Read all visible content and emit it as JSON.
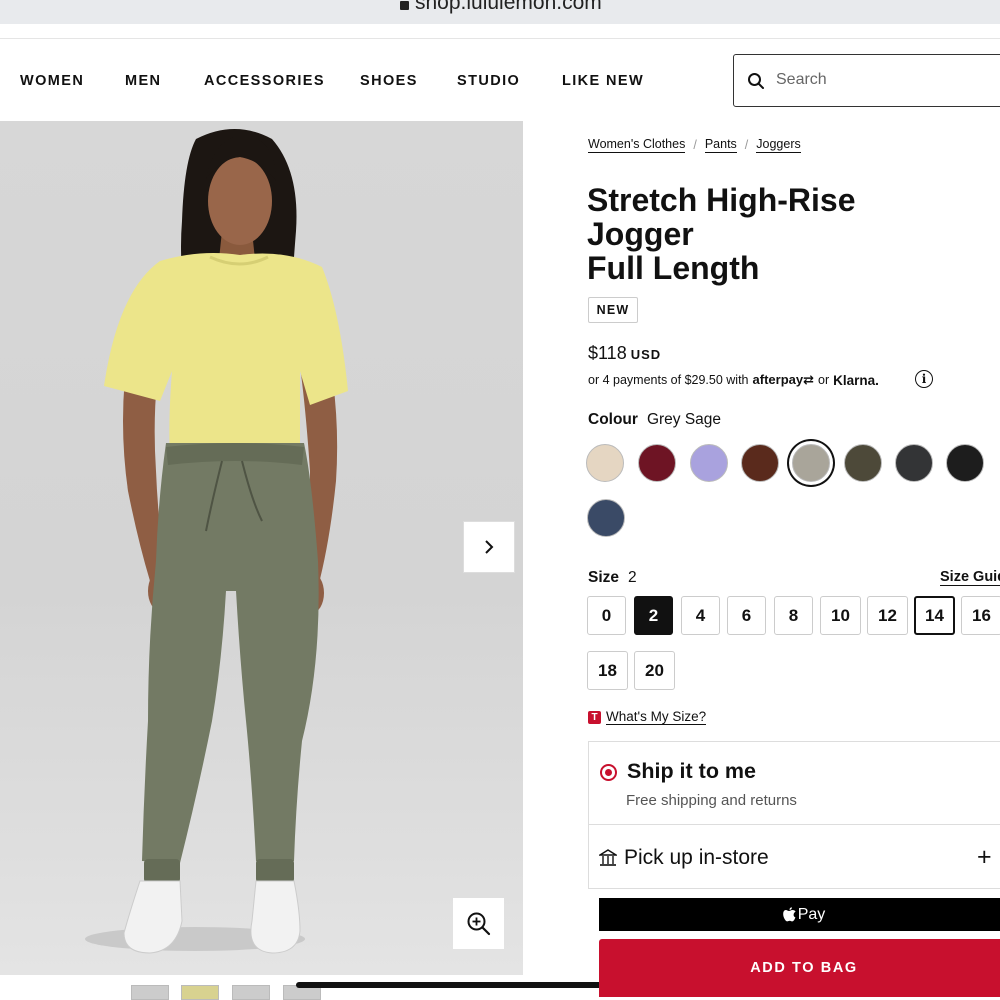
{
  "browser": {
    "url": "shop.lululemon.com"
  },
  "nav": {
    "items": [
      "WOMEN",
      "MEN",
      "ACCESSORIES",
      "SHOES",
      "STUDIO",
      "LIKE NEW"
    ],
    "search_placeholder": "Search"
  },
  "breadcrumb": [
    "Women's Clothes",
    "Pants",
    "Joggers"
  ],
  "breadcrumb_separator": "/",
  "product": {
    "title_lines": [
      "Stretch High-Rise",
      "Jogger",
      "Full Length"
    ],
    "badge": "NEW",
    "price": "$118",
    "currency": "USD",
    "installments": {
      "prefix": "or 4 payments of $29.50 with",
      "afterpay": "afterpay",
      "or": "or",
      "klarna": "Klarna."
    },
    "info_icon": "i"
  },
  "colour": {
    "label": "Colour",
    "selected_name": "Grey Sage",
    "swatches": [
      {
        "color": "#e5d6c2"
      },
      {
        "color": "#6e1424"
      },
      {
        "color": "#a9a2de"
      },
      {
        "color": "#5a2a1c"
      },
      {
        "color": "#a9a59a",
        "selected": true
      },
      {
        "color": "#4d4939"
      },
      {
        "color": "#333436"
      },
      {
        "color": "#1d1d1d"
      },
      {
        "color": "#3a4a66"
      }
    ]
  },
  "size": {
    "label": "Size",
    "selected": "2",
    "guide_label": "Size Guide",
    "options": [
      "0",
      "2",
      "4",
      "6",
      "8",
      "10",
      "12",
      "14",
      "16",
      "18",
      "20"
    ],
    "whats_my_size_icon": "T",
    "whats_my_size": "What's My Size?"
  },
  "shipping": {
    "ship_title": "Ship it to me",
    "ship_sub": "Free shipping and returns",
    "pickup_title": "Pick up in-store",
    "pickup_expand": "+"
  },
  "actions": {
    "applepay_label": "Pay",
    "add_to_bag": "ADD TO BAG"
  },
  "colors": {
    "accent": "#c8102e",
    "text": "#111111"
  }
}
